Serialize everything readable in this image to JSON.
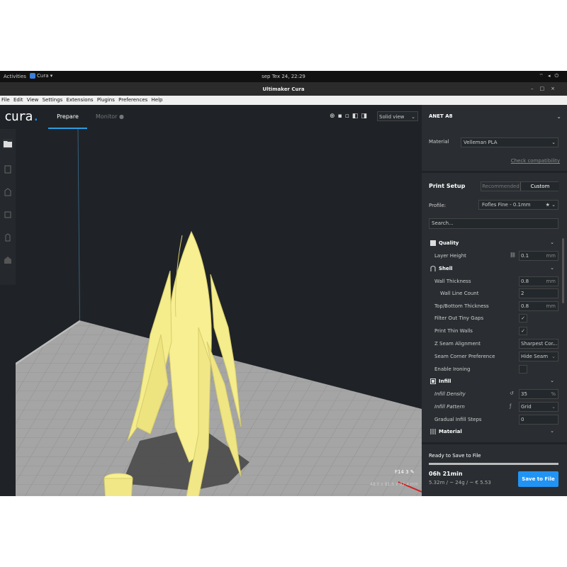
{
  "topbar": {
    "activities": "Activities",
    "app_menu": "Cura ▾",
    "clock": "sep Tex 24, 22:29",
    "tray_icons": [
      "network-icon",
      "volume-icon",
      "power-icon"
    ]
  },
  "window": {
    "title": "Ultimaker Cura"
  },
  "menubar": {
    "items": [
      "File",
      "Edit",
      "View",
      "Settings",
      "Extensions",
      "Plugins",
      "Preferences",
      "Help"
    ]
  },
  "header": {
    "logo": "cura",
    "tabs": [
      {
        "label": "Prepare",
        "active": true
      },
      {
        "label": "Monitor",
        "active": false
      }
    ],
    "view_mode": "Solid view"
  },
  "left_tools": [
    "open-file-icon",
    "move-icon",
    "scale-icon",
    "rotate-icon",
    "mirror-icon",
    "support-blocker-icon"
  ],
  "panel": {
    "printer": "ANET A8",
    "material_label": "Material",
    "material_value": "Velleman PLA",
    "check_compat": "Check compatibility",
    "print_setup": "Print Setup",
    "mode_recommended": "Recommended",
    "mode_custom": "Custom",
    "profile_label": "Profile:",
    "profile_value": "Fofles Fine - 0.1mm",
    "search_placeholder": "Search...",
    "settings": [
      {
        "kind": "cat",
        "label": "Quality"
      },
      {
        "kind": "row",
        "label": "Layer Height",
        "value": "0.1",
        "unit": "mm",
        "indent": 18,
        "icon": "link"
      },
      {
        "kind": "cat",
        "label": "Shell"
      },
      {
        "kind": "row",
        "label": "Wall Thickness",
        "value": "0.8",
        "unit": "mm",
        "indent": 18
      },
      {
        "kind": "row",
        "label": "Wall Line Count",
        "value": "2",
        "unit": "",
        "indent": 26
      },
      {
        "kind": "row",
        "label": "Top/Bottom Thickness",
        "value": "0.8",
        "unit": "mm",
        "indent": 18
      },
      {
        "kind": "check",
        "label": "Filter Out Tiny Gaps",
        "checked": "✓",
        "indent": 18
      },
      {
        "kind": "check",
        "label": "Print Thin Walls",
        "checked": "✓",
        "indent": 18
      },
      {
        "kind": "row",
        "label": "Z Seam Alignment",
        "value": "Sharpest Cor...",
        "unit": "⌄",
        "indent": 18
      },
      {
        "kind": "row",
        "label": "Seam Corner Preference",
        "value": "Hide Seam",
        "unit": "⌄",
        "indent": 18
      },
      {
        "kind": "check",
        "label": "Enable Ironing",
        "checked": "",
        "indent": 18
      },
      {
        "kind": "cat",
        "label": "Infill"
      },
      {
        "kind": "row",
        "label": "Infill Density",
        "value": "35",
        "unit": "%",
        "indent": 18,
        "icon": "reset"
      },
      {
        "kind": "row",
        "label": "Infill Pattern",
        "value": "Grid",
        "unit": "⌄",
        "indent": 18,
        "icon": "fx"
      },
      {
        "kind": "row",
        "label": "Gradual Infill Steps",
        "value": "0",
        "unit": "",
        "indent": 18
      },
      {
        "kind": "cat",
        "label": "Material"
      }
    ],
    "ready": "Ready to Save to File",
    "progress": 1.0,
    "time": "06h 21min",
    "cost": "5.32m / ~ 24g / ~ € 5.53",
    "save_button": "Save to File"
  },
  "scene": {
    "file_name": "F14 3",
    "dimensions": "48.0 x 81.6 x 92.4 mm"
  }
}
